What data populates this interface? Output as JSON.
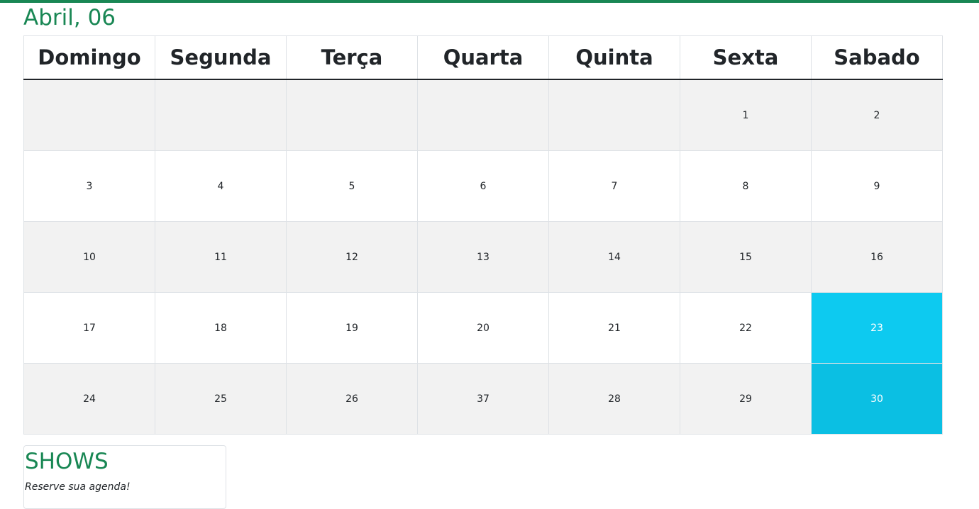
{
  "header": {
    "title": "Abril, 06"
  },
  "calendar": {
    "days_of_week": [
      "Domingo",
      "Segunda",
      "Terça",
      "Quarta",
      "Quinta",
      "Sexta",
      "Sabado"
    ],
    "weeks": [
      [
        "",
        "",
        "",
        "",
        "",
        "1",
        "2"
      ],
      [
        "3",
        "4",
        "5",
        "6",
        "7",
        "8",
        "9"
      ],
      [
        "10",
        "11",
        "12",
        "13",
        "14",
        "15",
        "16"
      ],
      [
        "17",
        "18",
        "19",
        "20",
        "21",
        "22",
        "23"
      ],
      [
        "24",
        "25",
        "26",
        "37",
        "28",
        "29",
        "30"
      ]
    ],
    "highlighted_days": [
      "23",
      "30"
    ]
  },
  "shows": {
    "title": "SHOWS",
    "subtitle": "Reserve sua agenda!"
  },
  "colors": {
    "accent": "#198754",
    "highlight": "#0dcaf0",
    "highlight_dark": "#0bbfe3"
  }
}
